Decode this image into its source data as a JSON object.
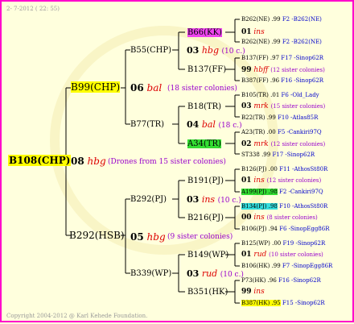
{
  "header": {
    "date": "2- 7-2012 ( 22: 55)"
  },
  "footer": {
    "copyright": "Copyright 2004-2012 @ Karl Kehede Foundation."
  },
  "root": {
    "label": "B108(CHP)",
    "num": "08",
    "race": "hbg",
    "note": "(Drones from 15 sister colonies)"
  },
  "l2": [
    {
      "label": "B99(CHP)",
      "num": "06",
      "race": "bal",
      "note": "(18 sister colonies)"
    },
    {
      "label": "B292(HSB)",
      "num": "05",
      "race": "hbg",
      "note": "(9 sister colonies)"
    }
  ],
  "l3": [
    {
      "label": "B55(CHP)",
      "num": "03",
      "race": "hbg",
      "note": "(10 c.)"
    },
    {
      "label": "B77(TR)",
      "num": "04",
      "race": "bal",
      "note": "(18 c.)"
    },
    {
      "label": "B292(PJ)",
      "num": "03",
      "race": "ins",
      "note": "(10 c.)"
    },
    {
      "label": "B339(WP)",
      "num": "03",
      "race": "rud",
      "note": "(10 c.)"
    }
  ],
  "l4": [
    {
      "label": "B66(KK)",
      "num": "01",
      "race": "ins",
      "note": ""
    },
    {
      "label": "B137(FF)",
      "num": "99",
      "race": "hbff",
      "note": "(12 sister colonies)"
    },
    {
      "label": "B18(TR)",
      "num": "03",
      "race": "mrk",
      "note": "(15 sister colonies)"
    },
    {
      "label": "A34(TR)",
      "num": "02",
      "race": "mrk",
      "note": "(12 sister colonies)"
    },
    {
      "label": "B191(PJ)",
      "num": "01",
      "race": "ins",
      "note": "(12 sister colonies)"
    },
    {
      "label": "B216(PJ)",
      "num": "00",
      "race": "ins",
      "note": "(8 sister colonies)"
    },
    {
      "label": "B149(WP)",
      "num": "01",
      "race": "rud",
      "note": "(10 sister colonies)"
    },
    {
      "label": "B351(HK)",
      "num": "99",
      "race": "ins",
      "note": ""
    }
  ],
  "l5": [
    {
      "label": "B262(NE)",
      "year": ".99",
      "code": "F2 -B262(NE)"
    },
    {
      "label": "B262(NE)",
      "year": ".99",
      "code": "F2 -B262(NE)"
    },
    {
      "label": "B137(FF)",
      "year": ".97",
      "code": "F17 -Sinop62R"
    },
    {
      "label": "B387(FF)",
      "year": ".96",
      "code": "F16 -Sinop62R"
    },
    {
      "label": "B105(TR)",
      "year": ".01",
      "code": "F6 -Old_Lady"
    },
    {
      "label": "B22(TR)",
      "year": ".99",
      "code": "F10 -Atlas85R"
    },
    {
      "label": "A23(TR)",
      "year": ".00",
      "code": "F5 -Cankiri97Q"
    },
    {
      "label": "ST338",
      "year": ".99",
      "code": "F17 -Sinop62R"
    },
    {
      "label": "B126(PJ)",
      "year": ".00",
      "code": "F11 -AthosSt80R"
    },
    {
      "label": "A199(PJ)",
      "year": ".98",
      "code": "F2 -Cankiri97Q"
    },
    {
      "label": "B134(PJ)",
      "year": ".98",
      "code": "F10 -AthosSt80R"
    },
    {
      "label": "B106(PJ)",
      "year": ".94",
      "code": "F6 -SinopEgg86R"
    },
    {
      "label": "B125(WP)",
      "year": ".00",
      "code": "F19 -Sinop62R"
    },
    {
      "label": "B106(HK)",
      "year": ".99",
      "code": "F7 -SinopEgg86R"
    },
    {
      "label": "P73(HK)",
      "year": ".96",
      "code": "F16 -Sinop62R"
    },
    {
      "label": "B387(HK)",
      "year": ".95",
      "code": "F15 -Sinop62R"
    }
  ]
}
